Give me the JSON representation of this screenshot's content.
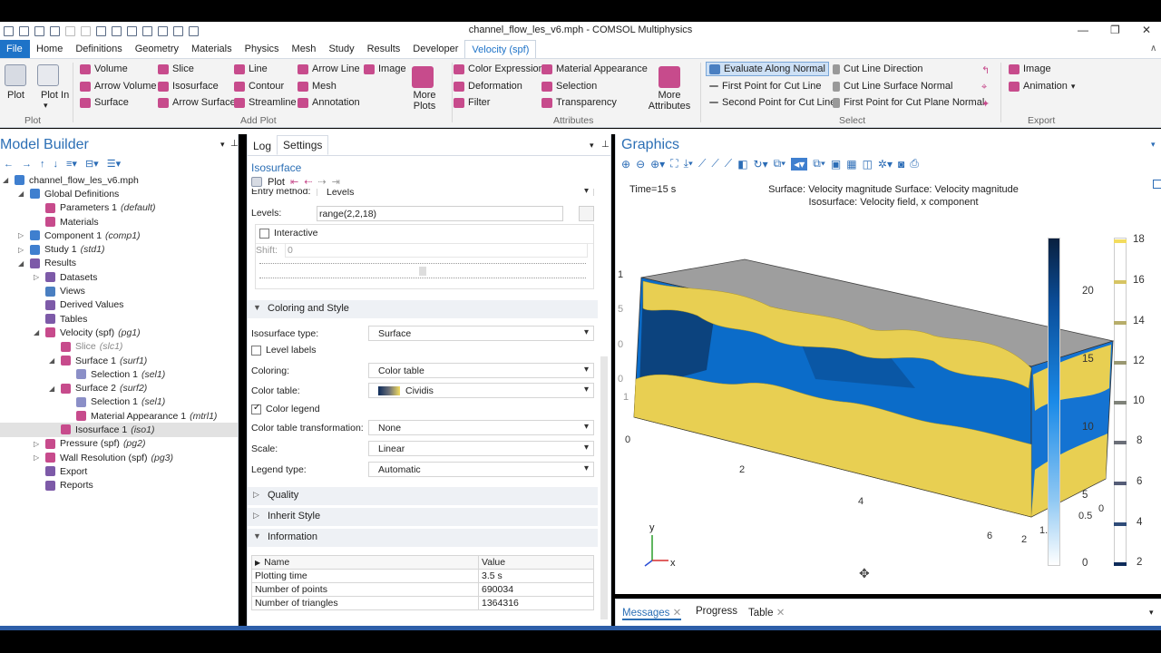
{
  "window": {
    "title": "channel_flow_les_v6.mph - COMSOL Multiphysics"
  },
  "menu_tabs": [
    "File",
    "Home",
    "Definitions",
    "Geometry",
    "Materials",
    "Physics",
    "Mesh",
    "Study",
    "Results",
    "Developer",
    "Velocity (spf)"
  ],
  "ribbon": {
    "plot": "Plot",
    "plot_in": "Plot In",
    "plot_group_label": "Plot",
    "add_plot_items": [
      "Volume",
      "Arrow Volume",
      "Surface",
      "Slice",
      "Isosurface",
      "Arrow Surface",
      "Line",
      "Contour",
      "Streamline",
      "Arrow Line",
      "Mesh",
      "Annotation",
      "Image"
    ],
    "more_plots": "More Plots",
    "add_plot_label": "Add Plot",
    "attr_items": [
      "Color Expression",
      "Deformation",
      "Filter",
      "Material Appearance",
      "Selection",
      "Transparency"
    ],
    "more_attributes": "More Attributes",
    "attributes_label": "Attributes",
    "select_items": [
      "Evaluate Along Normal",
      "First Point for Cut Line",
      "Second Point for Cut Line",
      "Cut Line Direction",
      "Cut Line Surface Normal",
      "First Point for Cut Plane Normal"
    ],
    "select_label": "Select",
    "export_items": [
      "Image",
      "Animation"
    ],
    "export_label": "Export"
  },
  "model_builder": {
    "title": "Model Builder",
    "tree": [
      {
        "label": "channel_flow_les_v6.mph",
        "tag": "",
        "indent": 0
      },
      {
        "label": "Global Definitions",
        "tag": "",
        "indent": 1
      },
      {
        "label": "Parameters 1",
        "tag": "(default)",
        "indent": 2
      },
      {
        "label": "Materials",
        "tag": "",
        "indent": 2
      },
      {
        "label": "Component 1",
        "tag": "(comp1)",
        "indent": 1
      },
      {
        "label": "Study 1",
        "tag": "(std1)",
        "indent": 1
      },
      {
        "label": "Results",
        "tag": "",
        "indent": 1
      },
      {
        "label": "Datasets",
        "tag": "",
        "indent": 2
      },
      {
        "label": "Views",
        "tag": "",
        "indent": 2
      },
      {
        "label": "Derived Values",
        "tag": "",
        "indent": 2
      },
      {
        "label": "Tables",
        "tag": "",
        "indent": 2
      },
      {
        "label": "Velocity (spf)",
        "tag": "(pg1)",
        "indent": 2
      },
      {
        "label": "Slice",
        "tag": "(slc1)",
        "indent": 3
      },
      {
        "label": "Surface 1",
        "tag": "(surf1)",
        "indent": 3
      },
      {
        "label": "Selection 1",
        "tag": "(sel1)",
        "indent": 4
      },
      {
        "label": "Surface 2",
        "tag": "(surf2)",
        "indent": 3
      },
      {
        "label": "Selection 1",
        "tag": "(sel1)",
        "indent": 4
      },
      {
        "label": "Material Appearance 1",
        "tag": "(mtrl1)",
        "indent": 4
      },
      {
        "label": "Isosurface 1",
        "tag": "(iso1)",
        "indent": 3
      },
      {
        "label": "Pressure (spf)",
        "tag": "(pg2)",
        "indent": 2
      },
      {
        "label": "Wall Resolution (spf)",
        "tag": "(pg3)",
        "indent": 2
      },
      {
        "label": "Export",
        "tag": "",
        "indent": 2
      },
      {
        "label": "Reports",
        "tag": "",
        "indent": 2
      }
    ]
  },
  "settings": {
    "tab_log": "Log",
    "tab_settings": "Settings",
    "node_title": "Isosurface",
    "plot_btn": "Plot",
    "entry_method_label": "Entry method:",
    "entry_method_value": "Levels",
    "levels_label": "Levels:",
    "levels_value": "range(2,2,18)",
    "interactive_label": "Interactive",
    "shift_label": "Shift:",
    "shift_value": "0",
    "coloring_section": "Coloring and Style",
    "iso_type_label": "Isosurface type:",
    "iso_type_value": "Surface",
    "level_labels": "Level labels",
    "coloring_label": "Coloring:",
    "coloring_value": "Color table",
    "color_table_label": "Color table:",
    "color_table_value": "Cividis",
    "color_legend": "Color legend",
    "ct_transform_label": "Color table transformation:",
    "ct_transform_value": "None",
    "scale_label": "Scale:",
    "scale_value": "Linear",
    "legend_type_label": "Legend type:",
    "legend_type_value": "Automatic",
    "quality_section": "Quality",
    "inherit_section": "Inherit Style",
    "info_section": "Information",
    "info_headers": [
      "Name",
      "Value"
    ],
    "info_rows": [
      [
        "Plotting time",
        "3.5 s"
      ],
      [
        "Number of points",
        "690034"
      ],
      [
        "Number of triangles",
        "1364316"
      ]
    ]
  },
  "graphics": {
    "title": "Graphics",
    "time_label": "Time=15 s",
    "plot_title_1": "Surface: Velocity magnitude  Surface: Velocity magnitude",
    "plot_title_2": "Isosurface: Velocity field, x component",
    "colorbar1_ticks": [
      "20",
      "15",
      "10",
      "5",
      "0"
    ],
    "colorbar2_ticks": [
      "18",
      "16",
      "14",
      "12",
      "10",
      "8",
      "6",
      "4",
      "2"
    ],
    "axis_labels": [
      "0",
      "2",
      "4",
      "6",
      "2",
      "1.",
      "0.5",
      "0",
      "1",
      "0",
      "5",
      "0",
      "1"
    ],
    "triad": {
      "y": "y",
      "x": "x"
    }
  },
  "messages": {
    "tabs": [
      "Messages",
      "Progress",
      "Table"
    ]
  },
  "colors": {
    "accent": "#1e73c8",
    "file_tab": "#1e73c8",
    "isosurface_gold": "#e8cf52",
    "velocity_blue": "#0a6fd0",
    "dark_blue": "#0d3a6b"
  }
}
